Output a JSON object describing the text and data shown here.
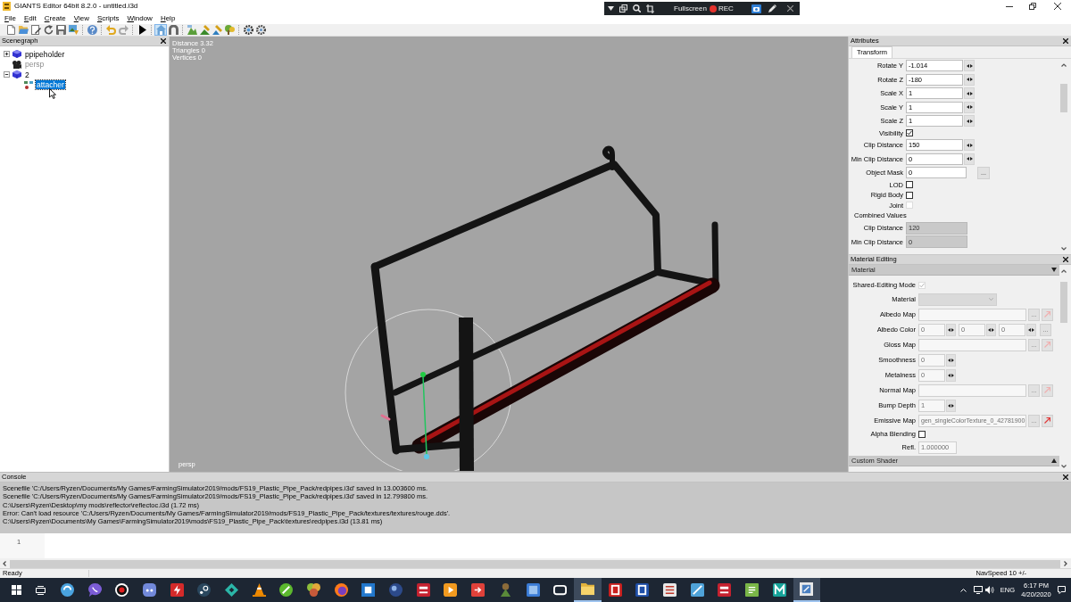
{
  "window": {
    "title": "GIANTS Editor 64bit 8.2.0 - untitled.i3d"
  },
  "recorder_toolbar": {
    "mode": "Fullscreen",
    "record": "REC"
  },
  "menu": [
    "File",
    "Edit",
    "Create",
    "View",
    "Scripts",
    "Window",
    "Help"
  ],
  "toolbar": [
    [
      {
        "kind": "new",
        "on": false
      },
      {
        "kind": "open",
        "on": false
      },
      {
        "kind": "edit",
        "on": false
      },
      {
        "kind": "reload",
        "on": false
      },
      {
        "kind": "save",
        "on": false
      },
      {
        "kind": "export",
        "on": false
      }
    ],
    [
      {
        "kind": "help",
        "on": false
      }
    ],
    [
      {
        "kind": "undo",
        "on": false
      },
      {
        "kind": "redo",
        "on": false
      }
    ],
    [
      {
        "kind": "play",
        "on": false
      }
    ],
    [
      {
        "kind": "home",
        "on": true
      },
      {
        "kind": "magnet",
        "on": false
      }
    ],
    [
      {
        "kind": "terrain",
        "on": false
      },
      {
        "kind": "paint",
        "on": false
      },
      {
        "kind": "sculpt",
        "on": false
      },
      {
        "kind": "foliage",
        "on": false
      }
    ],
    [
      {
        "kind": "settings",
        "on": false
      },
      {
        "kind": "plugins",
        "on": false
      }
    ]
  ],
  "scenegraph": {
    "title": "Scenegraph",
    "items": [
      {
        "label": "ppipeholder",
        "kind": "shape",
        "expanded": false,
        "hidden": false,
        "selected": false
      },
      {
        "label": "persp",
        "kind": "camera",
        "hidden": true,
        "selected": false
      },
      {
        "label": "2",
        "kind": "shape",
        "expanded": true,
        "hidden": false,
        "selected": false,
        "children": [
          {
            "label": "attacher",
            "kind": "transform",
            "hidden": false,
            "selected": true
          }
        ]
      }
    ]
  },
  "viewport": {
    "stats": [
      "Distance 3.32",
      "Triangles 0",
      "Vertices 0"
    ],
    "camera": "persp"
  },
  "attributes": {
    "title": "Attributes",
    "tabs": [
      {
        "label": "Transform",
        "selected": true
      }
    ],
    "rows": [
      {
        "kind": "number",
        "label": "Rotate Y",
        "value": "-1.014"
      },
      {
        "kind": "number",
        "label": "Rotate Z",
        "value": "-180"
      },
      {
        "kind": "number",
        "label": "Scale X",
        "value": "1"
      },
      {
        "kind": "number",
        "label": "Scale Y",
        "value": "1"
      },
      {
        "kind": "number",
        "label": "Scale Z",
        "value": "1"
      },
      {
        "kind": "checkbox",
        "label": "Visibility",
        "checked": true,
        "disabled": false
      },
      {
        "kind": "number",
        "label": "Clip Distance",
        "value": "150"
      },
      {
        "kind": "number",
        "label": "Min Clip Distance",
        "value": "0"
      },
      {
        "kind": "text",
        "label": "Object Mask",
        "value": "0",
        "button": "..."
      },
      {
        "kind": "checkbox",
        "label": "LOD",
        "checked": false,
        "disabled": false
      },
      {
        "kind": "checkbox",
        "label": "Rigid Body",
        "checked": false,
        "disabled": false
      },
      {
        "kind": "checkbox",
        "label": "Joint",
        "checked": false,
        "disabled": true
      },
      {
        "kind": "heading",
        "label": "Combined Values"
      },
      {
        "kind": "readonly",
        "label": "Clip Distance",
        "value": "120"
      },
      {
        "kind": "readonly",
        "label": "Min Clip Distance",
        "value": "0"
      }
    ]
  },
  "material_editing": {
    "title": "Material Editing",
    "disabled": true,
    "sections": [
      {
        "title": "Material",
        "expanded": true,
        "rows": [
          {
            "kind": "checkbox",
            "label": "Shared-Editing Mode",
            "checked": true,
            "disabled": true
          },
          {
            "kind": "dropdown",
            "label": "Material"
          },
          {
            "kind": "map",
            "label": "Albedo Map",
            "button": "..."
          },
          {
            "kind": "color",
            "label": "Albedo Color",
            "values": [
              "0",
              "0",
              "0"
            ],
            "button": "..."
          },
          {
            "kind": "map",
            "label": "Gloss Map",
            "button": "..."
          },
          {
            "kind": "number",
            "label": "Smoothness",
            "value": "0"
          },
          {
            "kind": "number",
            "label": "Metalness",
            "value": "0"
          },
          {
            "kind": "map",
            "label": "Normal Map",
            "button": "..."
          },
          {
            "kind": "number",
            "label": "Bump Depth",
            "value": "1"
          },
          {
            "kind": "map",
            "label": "Emissive Map",
            "value": "gen_singleColorTexture_0_42781900",
            "button": "..."
          },
          {
            "kind": "checkbox",
            "label": "Alpha Blending",
            "checked": false,
            "disabled": false
          },
          {
            "kind": "readonly",
            "label": "Refl.",
            "value": "1.000000"
          }
        ]
      },
      {
        "title": "Custom Shader",
        "expanded": false
      }
    ]
  },
  "console": {
    "title": "Console",
    "lines": [
      "Scenefile 'C:/Users/Ryzen/Documents/My Games/FarmingSimulator2019/mods/FS19_Plastic_Pipe_Pack/redpipes.i3d' saved in 13.003600 ms.",
      "Scenefile 'C:/Users/Ryzen/Documents/My Games/FarmingSimulator2019/mods/FS19_Plastic_Pipe_Pack/redpipes.i3d' saved in 12.799800 ms.",
      "C:\\Users\\Ryzen\\Desktop\\my mods\\reflector\\reflectoc.i3d (1.72 ms)",
      "Error: Can't load resource 'C:/Users/Ryzen/Documents/My Games/FarmingSimulator2019/mods/FS19_Plastic_Pipe_Pack/textures/textures/rouge.dds'.",
      "C:\\Users\\Ryzen\\Documents\\My Games\\FarmingSimulator2019\\mods\\FS19_Plastic_Pipe_Pack\\textures\\redpipes.i3d (13.81 ms)"
    ],
    "line_numbers": [
      "1"
    ]
  },
  "status_bar": {
    "message": "Ready",
    "nav_speed": "NavSpeed 10 +/-"
  },
  "taskbar": {
    "apps": [
      {
        "selected": false
      },
      {
        "selected": false
      },
      {
        "selected": false
      },
      {
        "selected": false
      },
      {
        "selected": false
      },
      {
        "selected": false
      },
      {
        "selected": false
      },
      {
        "selected": false
      },
      {
        "selected": false
      },
      {
        "selected": false
      },
      {
        "selected": false
      },
      {
        "selected": false
      },
      {
        "selected": false
      },
      {
        "selected": false
      },
      {
        "selected": false
      },
      {
        "selected": false
      },
      {
        "selected": false
      },
      {
        "selected": false
      },
      {
        "selected": false
      },
      {
        "selected": true
      },
      {
        "selected": false
      },
      {
        "selected": false
      },
      {
        "selected": false
      },
      {
        "selected": false
      },
      {
        "selected": false
      },
      {
        "selected": false
      },
      {
        "selected": false
      },
      {
        "selected": true
      }
    ],
    "language": "ENG",
    "time": "6:17 PM",
    "date": "4/20/2020"
  }
}
